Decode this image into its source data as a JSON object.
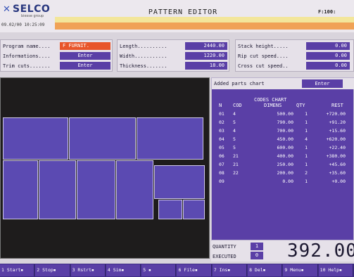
{
  "header": {
    "logo_text": "SELCO",
    "logo_tagline": "biesse group",
    "datetime": "09.02/00 10:25:09",
    "title": "PATTERN EDITOR",
    "page_id": "F:100:"
  },
  "params_left": {
    "rows": [
      {
        "label": "Program name....",
        "value": "F FURNIT."
      },
      {
        "label": "Informations....",
        "value": "Enter"
      },
      {
        "label": "Trim cuts.......",
        "value": "Enter"
      }
    ]
  },
  "params_mid": {
    "rows": [
      {
        "label": "Length..........",
        "value": "2440.00"
      },
      {
        "label": "Width...........",
        "value": "1220.00"
      },
      {
        "label": "Thickness.......",
        "value": "18.00"
      }
    ]
  },
  "params_right": {
    "rows": [
      {
        "label": "Stack height.....",
        "value": "0.00"
      },
      {
        "label": "Rip cut speed....",
        "value": "0.00"
      },
      {
        "label": "Cross cut speed..",
        "value": "0.00"
      }
    ]
  },
  "parts_chart": {
    "label": "Added parts chart",
    "enter": "Enter",
    "codes_chart_title": "CODES CHART",
    "columns": [
      "N",
      "COD",
      "DIMENS",
      "QTY",
      "REST"
    ],
    "rows": [
      {
        "n": "01",
        "cod": "4",
        "dim": "500.00",
        "qty": "1",
        "rest": "+720.00"
      },
      {
        "n": "02",
        "cod": "5",
        "dim": "790.00",
        "qty": "1",
        "rest": "+91.20"
      },
      {
        "n": "03",
        "cod": "4",
        "dim": "700.00",
        "qty": "1",
        "rest": "+15.60"
      },
      {
        "n": "04",
        "cod": "5",
        "dim": "450.00",
        "qty": "4",
        "rest": "+620.00"
      },
      {
        "n": "05",
        "cod": "5",
        "dim": "600.00",
        "qty": "1",
        "rest": "+22.40"
      },
      {
        "n": "06",
        "cod": "21",
        "dim": "400.00",
        "qty": "1",
        "rest": "+380.00"
      },
      {
        "n": "07",
        "cod": "21",
        "dim": "250.00",
        "qty": "1",
        "rest": "+45.60"
      },
      {
        "n": "08",
        "cod": "22",
        "dim": "200.00",
        "qty": "2",
        "rest": "+35.60"
      },
      {
        "n": "09",
        "cod": "",
        "dim": "0.00",
        "qty": "1",
        "rest": "+0.00"
      }
    ]
  },
  "quantity": {
    "quantity_label": "QUANTITY",
    "quantity_value": "1",
    "executed_label": "EXECUTED",
    "executed_value": "0",
    "big_number": "392.00"
  },
  "function_keys": [
    "1 Start▪",
    "2 Stop▪",
    "3 Rstrt▪",
    "4 Sim▪",
    "5 ▪",
    "6 File▪",
    "7 Ins▪",
    "8 Del▪",
    "9 Menu▪",
    "10 Help▪"
  ],
  "colors": {
    "panel_purple": "#5a3fa6",
    "canvas_dark": "#1e1c1c",
    "accent_orange": "#f0a256",
    "accent_yellow": "#f3e69a",
    "highlight_red": "#e8552a"
  }
}
